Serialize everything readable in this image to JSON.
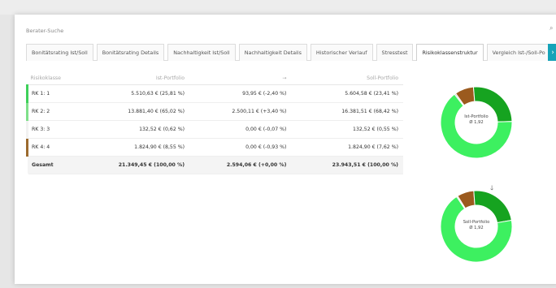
{
  "header": {
    "title": "Berater-Suche"
  },
  "tabs": [
    {
      "label": "Bonitätsrating Ist/Soll"
    },
    {
      "label": "Bonitätsrating Details"
    },
    {
      "label": "Nachhaltigkeit Ist/Soll"
    },
    {
      "label": "Nachhaltigkeit Details"
    },
    {
      "label": "Historischer Verlauf"
    },
    {
      "label": "Stresstest"
    },
    {
      "label": "Risikoklassenstruktur"
    },
    {
      "label": "Vergleich Ist-/Soll-Po"
    }
  ],
  "active_tab": "Risikoklassenstruktur",
  "table": {
    "headers": [
      "Risikoklasse",
      "Ist-Portfolio",
      "→",
      "Soll-Portfolio"
    ],
    "rows": [
      {
        "klasse": "RK 1: 1",
        "ist": "5.510,63 € (25,81 %)",
        "delta": "93,95 € (-2,40 %)",
        "soll": "5.604,58 € (23,41 %)",
        "color": "#3ed05a"
      },
      {
        "klasse": "RK 2: 2",
        "ist": "13.881,40 € (65,02 %)",
        "delta": "2.500,11 € (+3,40 %)",
        "soll": "16.381,51 € (68,42 %)",
        "color": "#7fe08a"
      },
      {
        "klasse": "RK 3: 3",
        "ist": "132,52 € (0,62 %)",
        "delta": "0,00 € (-0,07 %)",
        "soll": "132,52 € (0,55 %)",
        "color": "#f2f2f2"
      },
      {
        "klasse": "RK 4: 4",
        "ist": "1.824,90 € (8,55 %)",
        "delta": "0,00 € (-0,93 %)",
        "soll": "1.824,90 € (7,62 %)",
        "color": "#9b6a2e"
      }
    ],
    "total": {
      "klasse": "Gesamt",
      "ist": "21.349,45 € (100,00 %)",
      "delta": "2.594,06 € (+0,00 %)",
      "soll": "23.943,51 € (100,00 %)"
    }
  },
  "donuts": {
    "ist": {
      "title": "Ist-Portfolio",
      "value": "Ø 1,92"
    },
    "soll": {
      "title": "Soll-Portfolio",
      "value": "Ø 1,92"
    },
    "arrow": "🡓"
  },
  "chart_data": [
    {
      "type": "pie",
      "title": "Ist-Portfolio",
      "categories": [
        "RK 1",
        "RK 2",
        "RK 3",
        "RK 4"
      ],
      "values": [
        25.81,
        65.02,
        0.62,
        8.55
      ],
      "colors": [
        "#16a320",
        "#3df060",
        "#c9c9c9",
        "#9b5a1e"
      ]
    },
    {
      "type": "pie",
      "title": "Soll-Portfolio",
      "categories": [
        "RK 1",
        "RK 2",
        "RK 3",
        "RK 4"
      ],
      "values": [
        23.41,
        68.42,
        0.55,
        7.62
      ],
      "colors": [
        "#16a320",
        "#3df060",
        "#c9c9c9",
        "#9b5a1e"
      ]
    }
  ]
}
